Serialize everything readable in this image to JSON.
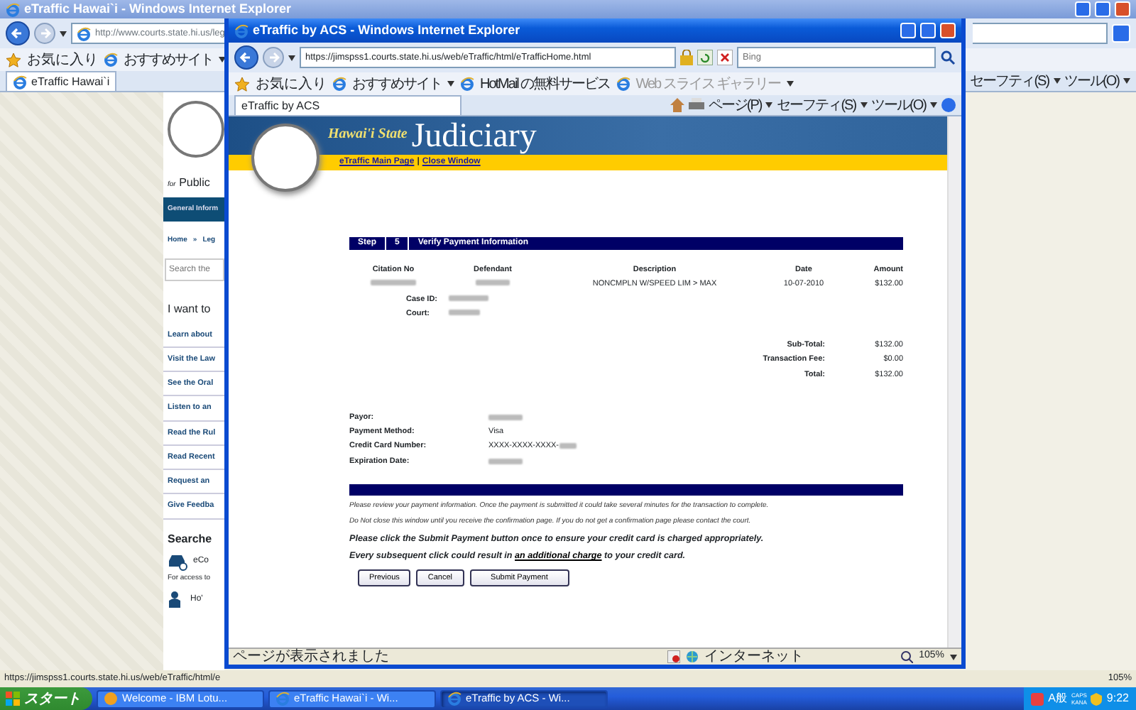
{
  "background_window": {
    "title": "eTraffic Hawai`i - Windows Internet Explorer",
    "address": "http://www.courts.state.hi.us/leg",
    "favorites_button": "お気に入り",
    "favorites": [
      "おすすめサイト"
    ],
    "tab": "eTraffic Hawai`i",
    "commands": [
      "セーフティ(S)",
      "ツール(O)"
    ],
    "page": {
      "tagline_prefix": "for",
      "tagline": "Public",
      "nav": "General Inform",
      "breadcrumb": [
        "Home",
        "»",
        "Leg"
      ],
      "search_placeholder": "Search the",
      "heading": "I want to",
      "links": [
        "Learn about",
        "Visit the Law",
        "See the Oral",
        "Listen to an",
        "Read the Rul",
        "Read Recent",
        "Request an",
        "Give Feedba"
      ],
      "section": "Searche",
      "services": [
        {
          "kind": "car",
          "title": "eCo",
          "text": "For access to"
        },
        {
          "kind": "person",
          "title": "Ho'"
        }
      ]
    },
    "status": "https://jimspss1.courts.state.hi.us/web/eTraffic/html/e",
    "zoom": "105%"
  },
  "popup": {
    "title": "eTraffic by ACS - Windows Internet Explorer",
    "address": "https://jimspss1.courts.state.hi.us/web/eTraffic/html/eTrafficHome.html",
    "search_placeholder": "Bing",
    "favorites_button": "お気に入り",
    "favorites": [
      {
        "label": "おすすめサイト",
        "disabled": false,
        "dropdown": true
      },
      {
        "label": "HotMail の無料サービス",
        "disabled": false,
        "dropdown": false
      },
      {
        "label": "Web スライス ギャラリー",
        "disabled": true,
        "dropdown": true
      }
    ],
    "tab": "eTraffic by ACS",
    "commands": [
      "ページ(P)",
      "セーフティ(S)",
      "ツール(O)"
    ],
    "page": {
      "brand_prefix": "Hawai'i State",
      "brand": "Judiciary",
      "links": [
        "eTraffic Main Page",
        "Close Window"
      ],
      "link_separator": "|",
      "step_label": "Step",
      "step_number": "5",
      "step_title": "Verify Payment Information",
      "columns": [
        "Citation No",
        "Defendant",
        "Description",
        "Date",
        "Amount"
      ],
      "row": {
        "description": "NONCMPLN W/SPEED LIM > MAX",
        "date": "10-07-2010",
        "amount": "$132.00"
      },
      "case_fields": [
        "Case ID:",
        "Court:"
      ],
      "totals": [
        {
          "label": "Sub-Total:",
          "value": "$132.00"
        },
        {
          "label": "Transaction Fee:",
          "value": "$0.00"
        },
        {
          "label": "Total:",
          "value": "$132.00"
        }
      ],
      "payment": [
        {
          "label": "Payor:"
        },
        {
          "label": "Payment Method:",
          "value": "Visa"
        },
        {
          "label": "Credit Card Number:",
          "value": "XXXX-XXXX-XXXX-"
        },
        {
          "label": "Expiration Date:"
        }
      ],
      "notes": [
        "Please review your payment information. Once the payment is submitted it could take several minutes for the transaction to complete.",
        "Do Not close this window until you receive the confirmation page. If you do not get a confirmation page please contact the court."
      ],
      "warning": "Please click the Submit Payment button once to ensure your credit card is charged appropriately.",
      "warning_link": {
        "before": "Every subsequent click could result in",
        "link": "an additional charge",
        "after": "to your credit card."
      },
      "buttons": [
        "Previous",
        "Cancel",
        "Submit Payment"
      ]
    },
    "status": "ページが表示されました",
    "zone": "インターネット",
    "zoom": "105%"
  },
  "taskbar": {
    "start": "スタート",
    "tasks": [
      {
        "label": "Welcome - IBM Lotu...",
        "kind": "mail",
        "selected": false
      },
      {
        "label": "eTraffic Hawai`i - Wi...",
        "kind": "browser",
        "selected": false
      },
      {
        "label": "eTraffic by ACS - Wi...",
        "kind": "browser",
        "selected": true
      }
    ],
    "ime": "A般",
    "indicators": [
      "CAPS",
      "KANA"
    ],
    "clock": "9:22"
  }
}
